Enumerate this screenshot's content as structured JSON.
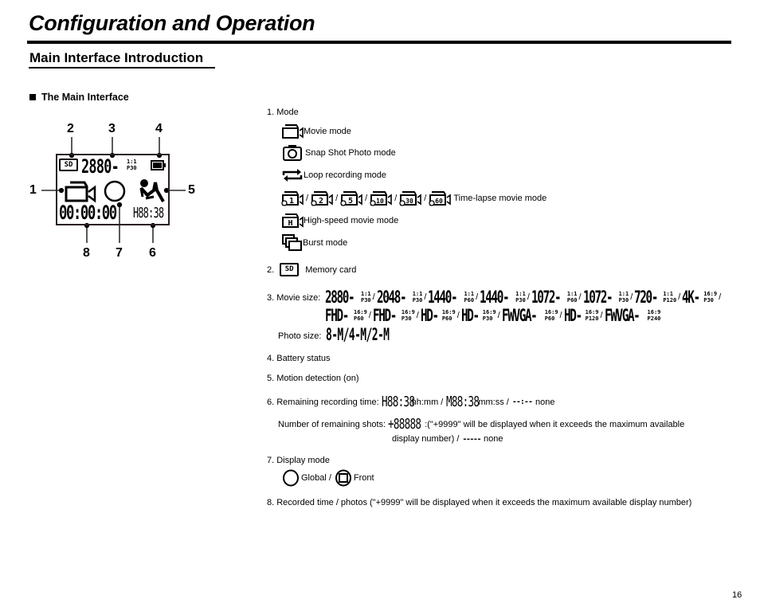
{
  "page": {
    "title": "Configuration and Operation",
    "section_title": "Main Interface Introduction",
    "sub_heading": "The Main Interface",
    "page_number": "16"
  },
  "diagram": {
    "callouts": [
      "1",
      "2",
      "3",
      "4",
      "5",
      "6",
      "7",
      "8"
    ],
    "lcd": {
      "memory_card": "SD",
      "movie_size": "2880-",
      "ratio": "1:1",
      "frame_rate": "P30",
      "recorded_time": "00:00:00",
      "remaining_time": "H88:38"
    },
    "icons": [
      "sd-card-icon",
      "battery-icon",
      "movie-camera-icon",
      "global-display-icon",
      "motion-detection-icon"
    ]
  },
  "legend": {
    "item1": {
      "label": "1.  Mode",
      "modes": [
        {
          "icon": "movie-mode-icon",
          "label": "Movie mode"
        },
        {
          "icon": "camera-icon",
          "label": "Snap Shot Photo mode"
        },
        {
          "icon": "loop-icon",
          "label": "Loop recording mode"
        },
        {
          "icon": "timelapse-icon",
          "label": "Time-lapse movie mode",
          "variants": [
            "1",
            "2",
            "5",
            "10",
            "30",
            "60"
          ]
        },
        {
          "icon": "high-speed-icon",
          "label": "High-speed movie mode",
          "glyph": "H"
        },
        {
          "icon": "burst-icon",
          "label": "Burst mode"
        }
      ]
    },
    "item2": {
      "label": "2.",
      "icon_text": "SD",
      "text": "Memory card"
    },
    "item3": {
      "label": "3.  Movie size:",
      "movie_sizes_row1": [
        {
          "size": "2880-",
          "ratio": "1:1",
          "fps": "P30"
        },
        {
          "size": "2048-",
          "ratio": "1:1",
          "fps": "P30"
        },
        {
          "size": "1440-",
          "ratio": "1:1",
          "fps": "P60"
        },
        {
          "size": "1440-",
          "ratio": "1:1",
          "fps": "P30"
        },
        {
          "size": "1072-",
          "ratio": "1:1",
          "fps": "P60"
        },
        {
          "size": "1072-",
          "ratio": "1:1",
          "fps": "P30"
        },
        {
          "size": "720-",
          "ratio": "1:1",
          "fps": "P120"
        },
        {
          "size": "4K-",
          "ratio": "16:9",
          "fps": "P30"
        }
      ],
      "movie_sizes_row2": [
        {
          "size": "FHD-",
          "ratio": "16:9",
          "fps": "P60"
        },
        {
          "size": "FHD-",
          "ratio": "16:9",
          "fps": "P30"
        },
        {
          "size": "HD-",
          "ratio": "16:9",
          "fps": "P60"
        },
        {
          "size": "HD-",
          "ratio": "16:9",
          "fps": "P30"
        },
        {
          "size": "FWVGA-",
          "ratio": "16:9",
          "fps": "P60"
        },
        {
          "size": "HD-",
          "ratio": "16:9",
          "fps": "P120"
        },
        {
          "size": "FWVGA-",
          "ratio": "16:9",
          "fps": "P240"
        }
      ],
      "photo_label": "Photo size:",
      "photo_sizes": "8-M/4-M/2-M"
    },
    "item4": "4.  Battery status",
    "item5": "5.  Motion detection (on)",
    "item6": {
      "label": "6.  Remaining recording time:",
      "hhmm_glyph": "H88:38",
      "hhmm_text": "hh:mm /",
      "mmss_glyph": "M88:38",
      "mmss_text": "mm:ss /",
      "none_glyph": "--:--",
      "none_text": "none",
      "shots_label": "Number of remaining shots:",
      "shots_glyph": "+88888",
      "shots_text": ":(\"+9999\" will be displayed when it exceeds the maximum available",
      "shots_text2": "display number) /",
      "shots_none_glyph": "-----",
      "shots_none_text": "none"
    },
    "item7": {
      "label": "7.  Display mode",
      "global": "Global /",
      "front": "Front"
    },
    "item8": "8.  Recorded time / photos (\"+9999\" will be displayed when it exceeds the maximum available display number)"
  }
}
